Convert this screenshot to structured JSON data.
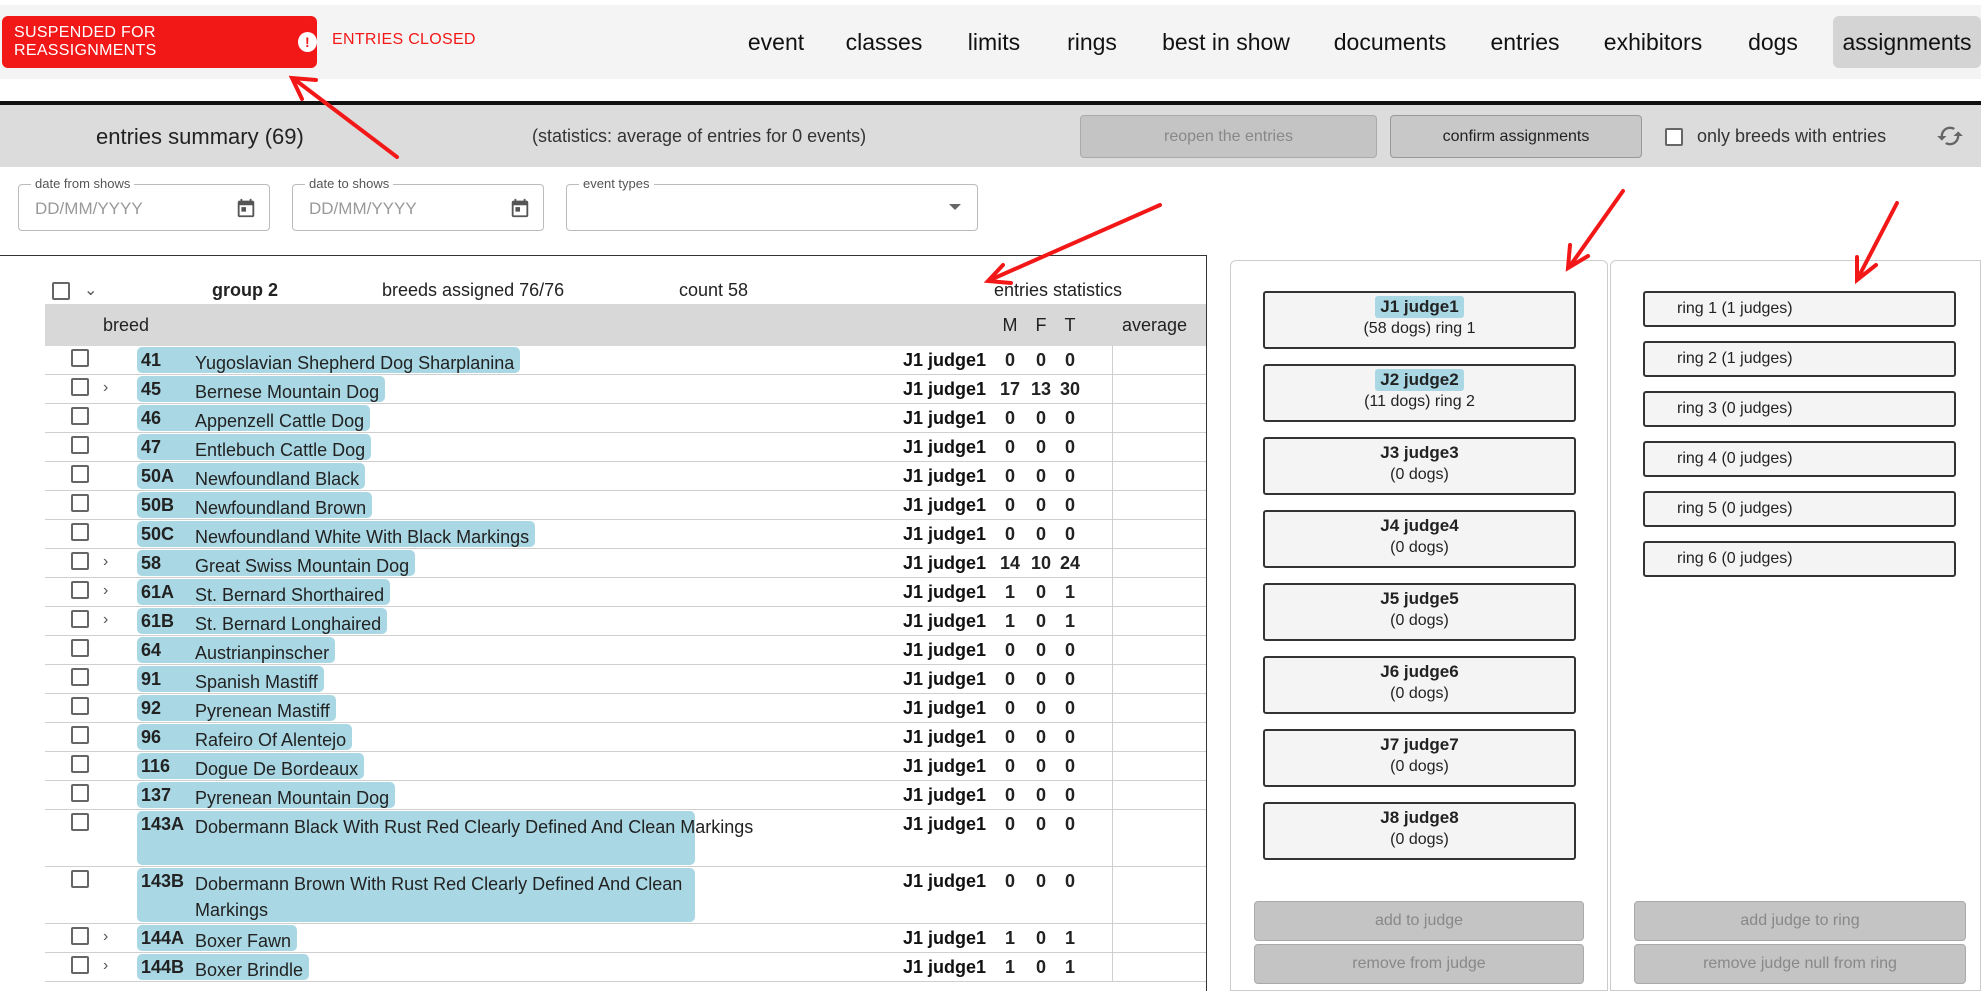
{
  "header": {
    "suspended_label": "SUSPENDED FOR REASSIGNMENTS",
    "entries_status": "ENTRIES CLOSED",
    "nav": [
      "event",
      "classes",
      "limits",
      "rings",
      "best in show",
      "documents",
      "entries",
      "exhibitors",
      "dogs",
      "assignments"
    ],
    "active_nav": "assignments",
    "accent_color": "#f31818"
  },
  "summary": {
    "title": "entries summary (69)",
    "stats": "(statistics: average of entries for 0 events)",
    "reopen_label": "reopen the entries",
    "confirm_label": "confirm assignments",
    "only_breeds_label": "only breeds with entries"
  },
  "filters": {
    "date_from_label": "date from shows",
    "date_to_label": "date to shows",
    "date_placeholder": "DD/MM/YYYY",
    "event_types_label": "event types"
  },
  "group": {
    "name": "group 2",
    "breeds_assigned": "breeds assigned 76/76",
    "count": "count 58",
    "stats_label": "entries statistics"
  },
  "table": {
    "breed_header": "breed",
    "m_header": "M",
    "f_header": "F",
    "t_header": "T",
    "avg_header": "average",
    "rows": [
      {
        "code": "41",
        "name": "Yugoslavian Shepherd Dog Sharplanina",
        "judge": "J1 judge1",
        "m": "0",
        "f": "0",
        "t": "0",
        "expand": false
      },
      {
        "code": "45",
        "name": "Bernese Mountain Dog",
        "judge": "J1 judge1",
        "m": "17",
        "f": "13",
        "t": "30",
        "expand": true
      },
      {
        "code": "46",
        "name": "Appenzell Cattle Dog",
        "judge": "J1 judge1",
        "m": "0",
        "f": "0",
        "t": "0",
        "expand": false
      },
      {
        "code": "47",
        "name": "Entlebuch Cattle Dog",
        "judge": "J1 judge1",
        "m": "0",
        "f": "0",
        "t": "0",
        "expand": false
      },
      {
        "code": "50A",
        "name": "Newfoundland Black",
        "judge": "J1 judge1",
        "m": "0",
        "f": "0",
        "t": "0",
        "expand": false
      },
      {
        "code": "50B",
        "name": "Newfoundland Brown",
        "judge": "J1 judge1",
        "m": "0",
        "f": "0",
        "t": "0",
        "expand": false
      },
      {
        "code": "50C",
        "name": "Newfoundland White With Black Markings",
        "judge": "J1 judge1",
        "m": "0",
        "f": "0",
        "t": "0",
        "expand": false
      },
      {
        "code": "58",
        "name": "Great Swiss Mountain Dog",
        "judge": "J1 judge1",
        "m": "14",
        "f": "10",
        "t": "24",
        "expand": true
      },
      {
        "code": "61A",
        "name": "St. Bernard Shorthaired",
        "judge": "J1 judge1",
        "m": "1",
        "f": "0",
        "t": "1",
        "expand": true
      },
      {
        "code": "61B",
        "name": "St. Bernard Longhaired",
        "judge": "J1 judge1",
        "m": "1",
        "f": "0",
        "t": "1",
        "expand": true
      },
      {
        "code": "64",
        "name": "Austrianpinscher",
        "judge": "J1 judge1",
        "m": "0",
        "f": "0",
        "t": "0",
        "expand": false
      },
      {
        "code": "91",
        "name": "Spanish Mastiff",
        "judge": "J1 judge1",
        "m": "0",
        "f": "0",
        "t": "0",
        "expand": false
      },
      {
        "code": "92",
        "name": "Pyrenean Mastiff",
        "judge": "J1 judge1",
        "m": "0",
        "f": "0",
        "t": "0",
        "expand": false
      },
      {
        "code": "96",
        "name": "Rafeiro Of Alentejo",
        "judge": "J1 judge1",
        "m": "0",
        "f": "0",
        "t": "0",
        "expand": false
      },
      {
        "code": "116",
        "name": "Dogue De Bordeaux",
        "judge": "J1 judge1",
        "m": "0",
        "f": "0",
        "t": "0",
        "expand": false
      },
      {
        "code": "137",
        "name": "Pyrenean Mountain Dog",
        "judge": "J1 judge1",
        "m": "0",
        "f": "0",
        "t": "0",
        "expand": false
      },
      {
        "code": "143A",
        "name": "Dobermann Black With Rust Red Clearly Defined And Clean Markings",
        "judge": "J1 judge1",
        "m": "0",
        "f": "0",
        "t": "0",
        "expand": false,
        "tall": true
      },
      {
        "code": "143B",
        "name": "Dobermann Brown With Rust Red Clearly Defined And Clean Markings",
        "judge": "J1 judge1",
        "m": "0",
        "f": "0",
        "t": "0",
        "expand": false,
        "tall": true
      },
      {
        "code": "144A",
        "name": "Boxer Fawn",
        "judge": "J1 judge1",
        "m": "1",
        "f": "0",
        "t": "1",
        "expand": true
      },
      {
        "code": "144B",
        "name": "Boxer Brindle",
        "judge": "J1 judge1",
        "m": "1",
        "f": "0",
        "t": "1",
        "expand": true
      }
    ]
  },
  "judges": [
    {
      "name": "J1 judge1",
      "sub": "(58 dogs) ring 1",
      "highlight": true
    },
    {
      "name": "J2 judge2",
      "sub": "(11 dogs) ring 2",
      "highlight": true
    },
    {
      "name": "J3 judge3",
      "sub": "(0 dogs)",
      "highlight": false
    },
    {
      "name": "J4 judge4",
      "sub": "(0 dogs)",
      "highlight": false
    },
    {
      "name": "J5 judge5",
      "sub": "(0 dogs)",
      "highlight": false
    },
    {
      "name": "J6 judge6",
      "sub": "(0 dogs)",
      "highlight": false
    },
    {
      "name": "J7 judge7",
      "sub": "(0 dogs)",
      "highlight": false
    },
    {
      "name": "J8 judge8",
      "sub": "(0 dogs)",
      "highlight": false
    }
  ],
  "judge_actions": {
    "add": "add to judge",
    "remove": "remove from judge"
  },
  "rings": [
    "ring 1 (1 judges)",
    "ring 2 (1 judges)",
    "ring 3 (0 judges)",
    "ring 4 (0 judges)",
    "ring 5 (0 judges)",
    "ring 6 (0 judges)"
  ],
  "ring_actions": {
    "add": "add judge to ring",
    "remove": "remove judge null from ring"
  }
}
